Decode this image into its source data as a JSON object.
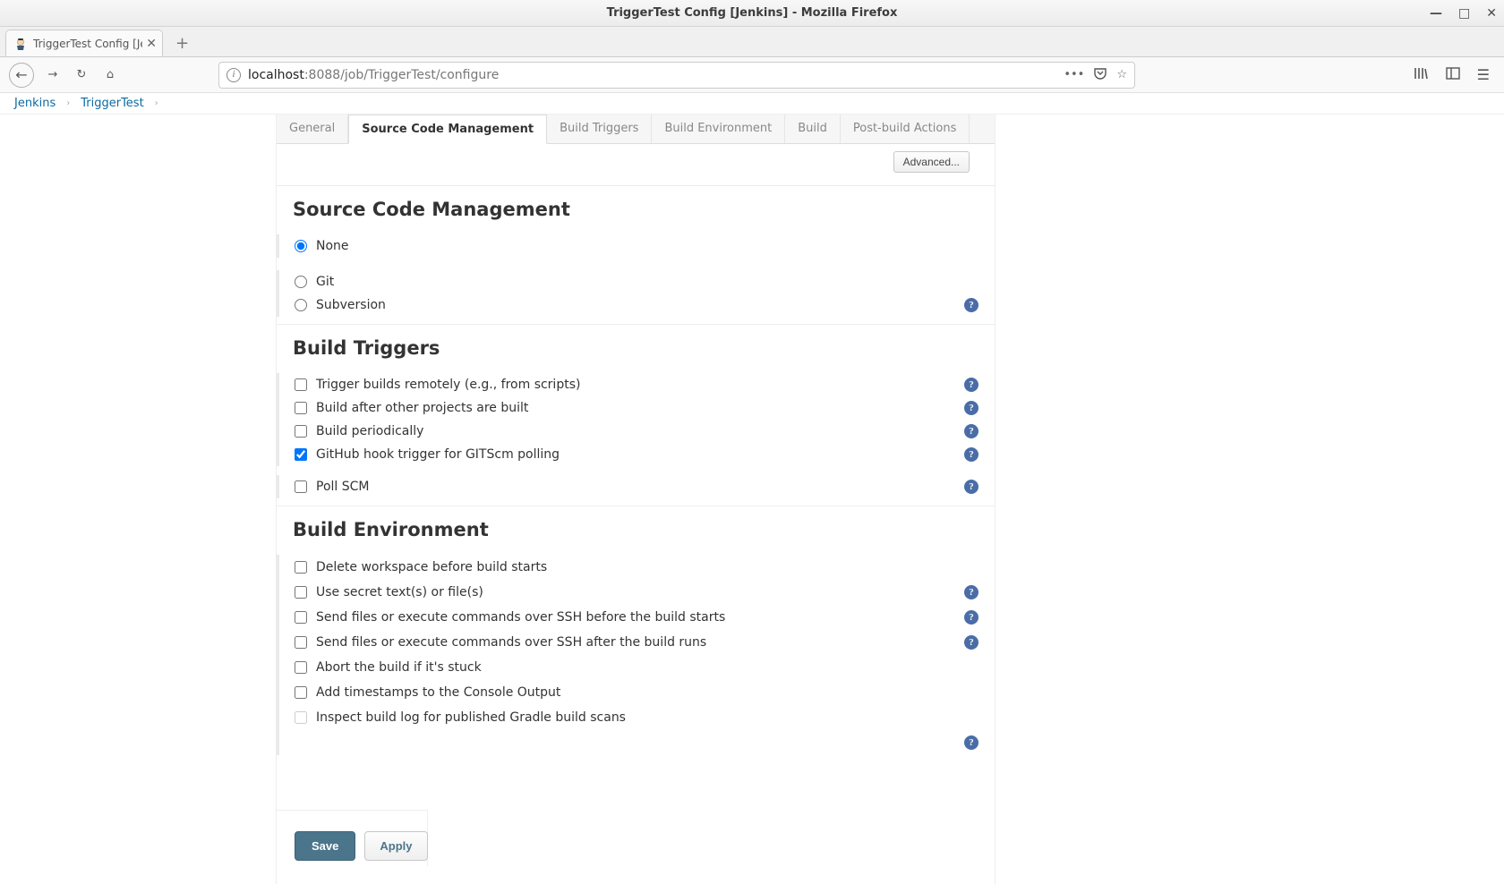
{
  "window": {
    "title": "TriggerTest Config [Jenkins] - Mozilla Firefox"
  },
  "browser_tab": {
    "title": "TriggerTest Config [Jenk"
  },
  "url": {
    "prefix": "localhost",
    "rest": ":8088/job/TriggerTest/configure"
  },
  "breadcrumbs": [
    "Jenkins",
    "TriggerTest"
  ],
  "tabs": [
    {
      "label": "General"
    },
    {
      "label": "Source Code Management"
    },
    {
      "label": "Build Triggers"
    },
    {
      "label": "Build Environment"
    },
    {
      "label": "Build"
    },
    {
      "label": "Post-build Actions"
    }
  ],
  "active_tab_index": 1,
  "advanced_label": "Advanced...",
  "sections": {
    "scm": {
      "title": "Source Code Management"
    },
    "triggers": {
      "title": "Build Triggers"
    },
    "env": {
      "title": "Build Environment"
    }
  },
  "scm_options": [
    {
      "label": "None",
      "checked": true,
      "help": false
    },
    {
      "label": "Git",
      "checked": false,
      "help": false
    },
    {
      "label": "Subversion",
      "checked": false,
      "help": true
    }
  ],
  "trigger_options": [
    {
      "label": "Trigger builds remotely (e.g., from scripts)",
      "checked": false,
      "help": true
    },
    {
      "label": "Build after other projects are built",
      "checked": false,
      "help": true
    },
    {
      "label": "Build periodically",
      "checked": false,
      "help": true
    },
    {
      "label": "GitHub hook trigger for GITScm polling",
      "checked": true,
      "help": true
    },
    {
      "label": "Poll SCM",
      "checked": false,
      "help": true
    }
  ],
  "env_options": [
    {
      "label": "Delete workspace before build starts",
      "checked": false,
      "help": false
    },
    {
      "label": "Use secret text(s) or file(s)",
      "checked": false,
      "help": true
    },
    {
      "label": "Send files or execute commands over SSH before the build starts",
      "checked": false,
      "help": true
    },
    {
      "label": "Send files or execute commands over SSH after the build runs",
      "checked": false,
      "help": true
    },
    {
      "label": "Abort the build if it's stuck",
      "checked": false,
      "help": false
    },
    {
      "label": "Add timestamps to the Console Output",
      "checked": false,
      "help": false
    },
    {
      "label": "Inspect build log for published Gradle build scans",
      "checked": false,
      "help": false,
      "faded": true
    },
    {
      "label": "",
      "checked": false,
      "help": true,
      "hidden_label": true
    }
  ],
  "buttons": {
    "save": "Save",
    "apply": "Apply"
  }
}
